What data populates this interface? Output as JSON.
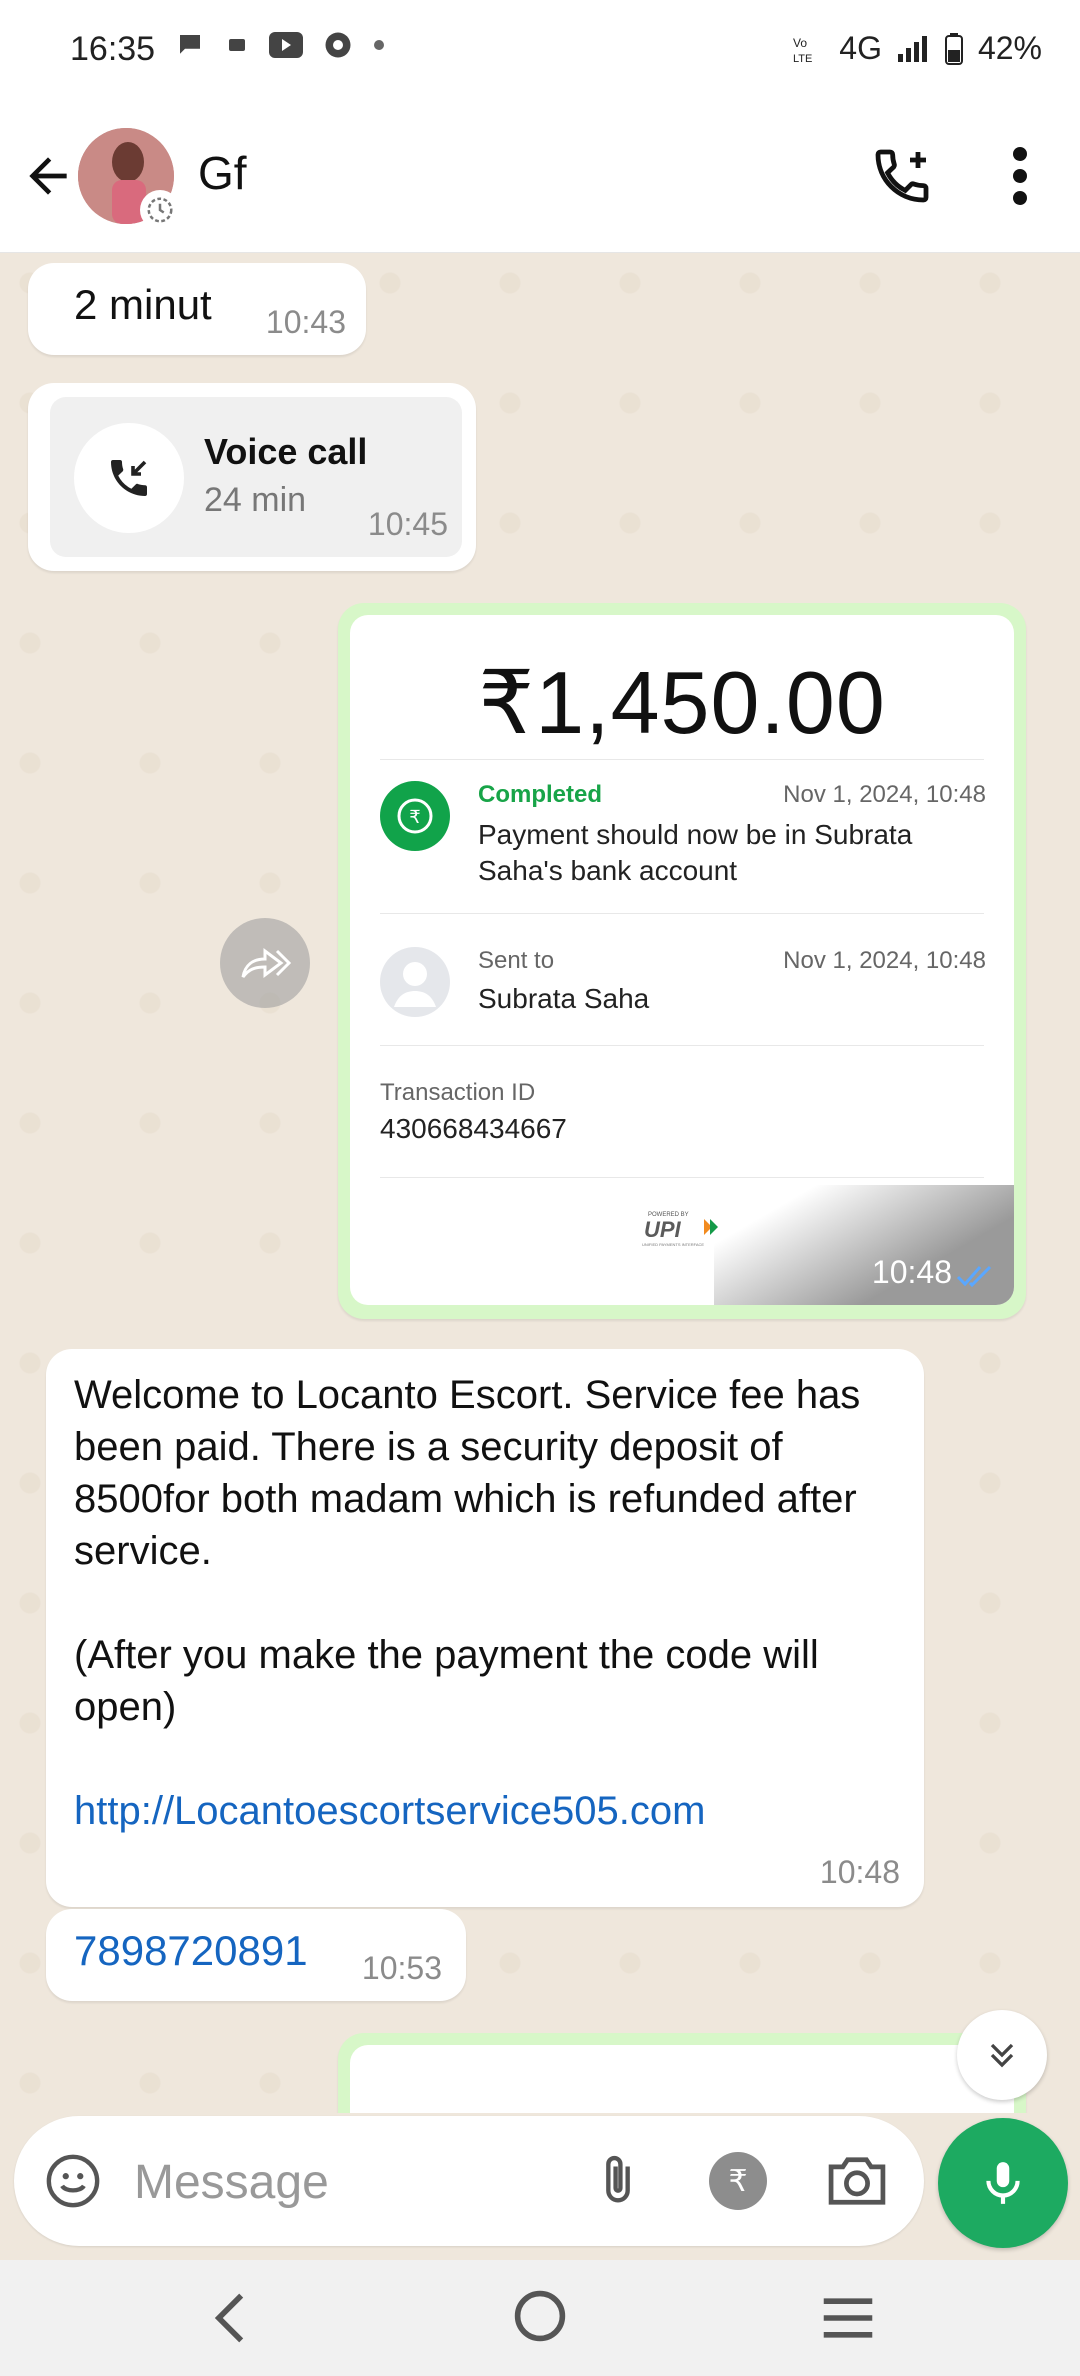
{
  "status_bar": {
    "time": "16:35",
    "network": "4G",
    "battery": "42%"
  },
  "header": {
    "contact_name": "Gf"
  },
  "messages": {
    "m1": {
      "text": "2 minut",
      "time": "10:43"
    },
    "call": {
      "title": "Voice call",
      "duration": "24 min",
      "time": "10:45"
    },
    "payment": {
      "amount": "₹1,450.00",
      "status": "Completed",
      "status_date": "Nov 1, 2024, 10:48",
      "status_desc": "Payment should now be in Subrata Saha's bank account",
      "sent_label": "Sent to",
      "sent_date": "Nov 1, 2024, 10:48",
      "sent_name": "Subrata Saha",
      "txn_label": "Transaction ID",
      "txn_id": "430668434667",
      "logo_top": "POWERED BY",
      "logo": "UPI",
      "logo_sub": "UNIFIED PAYMENTS INTERFACE",
      "time": "10:48"
    },
    "long": {
      "text": "Welcome to Locanto Escort. Service fee has been paid. There is a security deposit of 8500for both madam which is refunded after service.\n\n(After you make the payment the code will open)\n\n",
      "link": "http://Locantoescortservice505.com",
      "time": "10:48"
    },
    "phone": {
      "text": "7898720891",
      "time": "10:53"
    }
  },
  "composer": {
    "placeholder": "Message"
  },
  "colors": {
    "accent": "#1daa61",
    "link": "#1565c0",
    "chat_bg": "#efe7dc",
    "outgoing": "#d7f7c8"
  }
}
